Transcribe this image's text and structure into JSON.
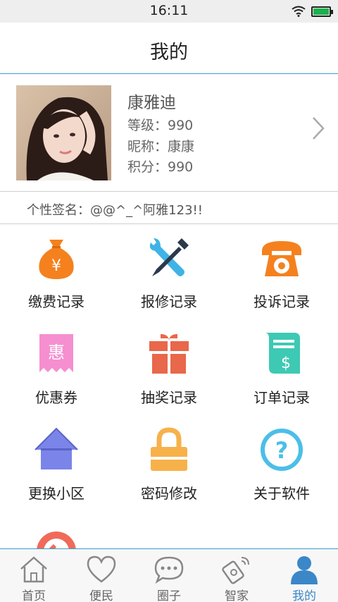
{
  "status_bar": {
    "time": "16:11"
  },
  "header": {
    "title": "我的"
  },
  "profile": {
    "name": "康雅迪",
    "level": "等级：990",
    "nickname": "昵称：康康",
    "points": "积分：990",
    "signature": "个性签名：@@^_^阿雅123!!"
  },
  "grid": [
    {
      "label": "缴费记录",
      "icon": "money-bag-icon",
      "color": "#f5811e"
    },
    {
      "label": "报修记录",
      "icon": "repair-tools-icon",
      "color": "#3fb3e6"
    },
    {
      "label": "投诉记录",
      "icon": "telephone-icon",
      "color": "#f5811e"
    },
    {
      "label": "优惠券",
      "icon": "coupon-icon",
      "color": "#f58fd0"
    },
    {
      "label": "抽奖记录",
      "icon": "gift-box-icon",
      "color": "#e9674a"
    },
    {
      "label": "订单记录",
      "icon": "receipt-icon",
      "color": "#3ec9b4"
    },
    {
      "label": "更换小区",
      "icon": "house-icon",
      "color": "#7b84e8"
    },
    {
      "label": "密码修改",
      "icon": "padlock-icon",
      "color": "#f7b14a"
    },
    {
      "label": "关于软件",
      "icon": "question-icon",
      "color": "#4bbfe8"
    },
    {
      "label": "",
      "icon": "logout-icon",
      "color": "#f06a5a"
    }
  ],
  "tabbar": [
    {
      "label": "首页",
      "icon": "home-icon"
    },
    {
      "label": "便民",
      "icon": "heart-icon"
    },
    {
      "label": "圈子",
      "icon": "chat-icon"
    },
    {
      "label": "智家",
      "icon": "smart-home-icon"
    },
    {
      "label": "我的",
      "icon": "user-icon",
      "active": true
    }
  ]
}
